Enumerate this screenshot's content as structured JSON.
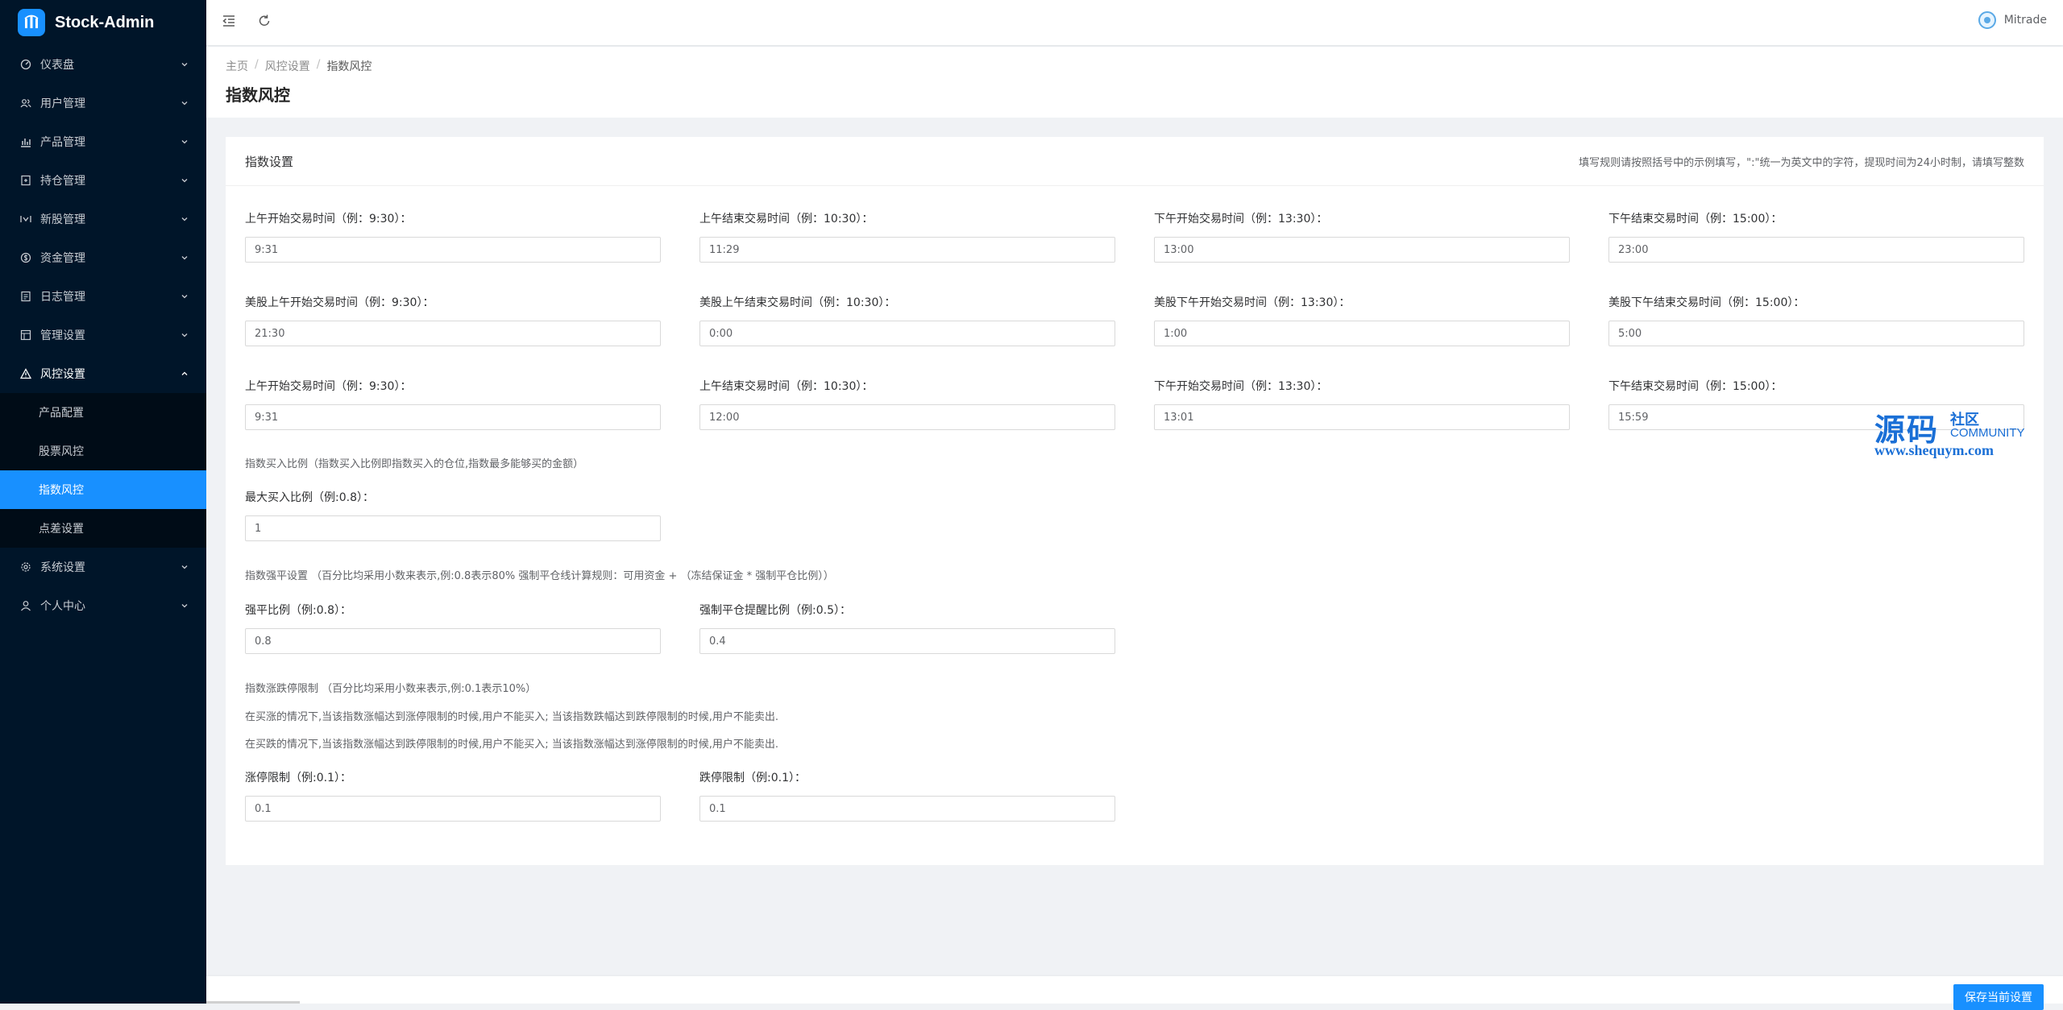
{
  "app": {
    "title": "Stock-Admin"
  },
  "sidebar": {
    "items": [
      {
        "label": "仪表盘",
        "icon": "dashboard-icon"
      },
      {
        "label": "用户管理",
        "icon": "users-icon"
      },
      {
        "label": "产品管理",
        "icon": "chart-icon"
      },
      {
        "label": "持仓管理",
        "icon": "position-icon"
      },
      {
        "label": "新股管理",
        "icon": "ipo-icon"
      },
      {
        "label": "资金管理",
        "icon": "money-icon"
      },
      {
        "label": "日志管理",
        "icon": "log-icon"
      },
      {
        "label": "管理设置",
        "icon": "admin-icon"
      },
      {
        "label": "风控设置",
        "icon": "warning-icon",
        "open": true
      },
      {
        "label": "系统设置",
        "icon": "gear-icon"
      },
      {
        "label": "个人中心",
        "icon": "user-icon"
      }
    ],
    "risk_sub": [
      {
        "label": "产品配置"
      },
      {
        "label": "股票风控"
      },
      {
        "label": "指数风控",
        "active": true
      },
      {
        "label": "点差设置"
      }
    ]
  },
  "header": {
    "user_name": "Mitrade"
  },
  "breadcrumb": {
    "home": "主页",
    "parent": "风控设置",
    "current": "指数风控"
  },
  "page": {
    "title": "指数风控"
  },
  "card": {
    "title": "指数设置",
    "note": "填写规则请按照括号中的示例填写，\":\"统一为英文中的字符，提现时间为24小时制，请填写整数"
  },
  "form": {
    "am_start": {
      "label": "上午开始交易时间（例：9:30）：",
      "value": "9:31"
    },
    "am_end": {
      "label": "上午结束交易时间（例：10:30）：",
      "value": "11:29"
    },
    "pm_start": {
      "label": "下午开始交易时间（例：13:30）：",
      "value": "13:00"
    },
    "pm_end": {
      "label": "下午结束交易时间（例：15:00）：",
      "value": "23:00"
    },
    "us_am_start": {
      "label": "美股上午开始交易时间（例：9:30）：",
      "value": "21:30"
    },
    "us_am_end": {
      "label": "美股上午结束交易时间（例：10:30）：",
      "value": "0:00"
    },
    "us_pm_start": {
      "label": "美股下午开始交易时间（例：13:30）：",
      "value": "1:00"
    },
    "us_pm_end": {
      "label": "美股下午结束交易时间（例：15:00）：",
      "value": "5:00"
    },
    "am_start2": {
      "label": "上午开始交易时间（例：9:30）：",
      "value": "9:31"
    },
    "am_end2": {
      "label": "上午结束交易时间（例：10:30）：",
      "value": "12:00"
    },
    "pm_start2": {
      "label": "下午开始交易时间（例：13:30）：",
      "value": "13:01"
    },
    "pm_end2": {
      "label": "下午结束交易时间（例：15:00）：",
      "value": "15:59"
    },
    "buy_ratio_note": "指数买入比例（指数买入比例即指数买入的仓位,指数最多能够买的金额）",
    "max_buy": {
      "label": "最大买入比例（例:0.8）：",
      "value": "1"
    },
    "force_note": "指数强平设置 （百分比均采用小数来表示,例:0.8表示80% 强制平仓线计算规则：可用资金 + （冻结保证金 * 强制平仓比例））",
    "force_ratio": {
      "label": "强平比例（例:0.8）：",
      "value": "0.8"
    },
    "force_warn": {
      "label": "强制平仓提醒比例（例:0.5）：",
      "value": "0.4"
    },
    "limit_note": "指数涨跌停限制 （百分比均采用小数来表示,例:0.1表示10%）",
    "limit_desc1": "在买涨的情况下,当该指数涨幅达到涨停限制的时候,用户不能买入; 当该指数跌幅达到跌停限制的时候,用户不能卖出.",
    "limit_desc2": "在买跌的情况下,当该指数涨幅达到跌停限制的时候,用户不能买入; 当该指数涨幅达到涨停限制的时候,用户不能卖出.",
    "up_limit": {
      "label": "涨停限制（例:0.1）：",
      "value": "0.1"
    },
    "down_limit": {
      "label": "跌停限制（例:0.1）：",
      "value": "0.1"
    }
  },
  "watermark": {
    "main": "源码",
    "side1": "社区",
    "side2": "COMMUNITY",
    "url": "www.shequym.com"
  },
  "footer": {
    "save_label": "保存当前设置"
  },
  "colors": {
    "sidebar_bg": "#001529",
    "accent": "#1890ff"
  }
}
